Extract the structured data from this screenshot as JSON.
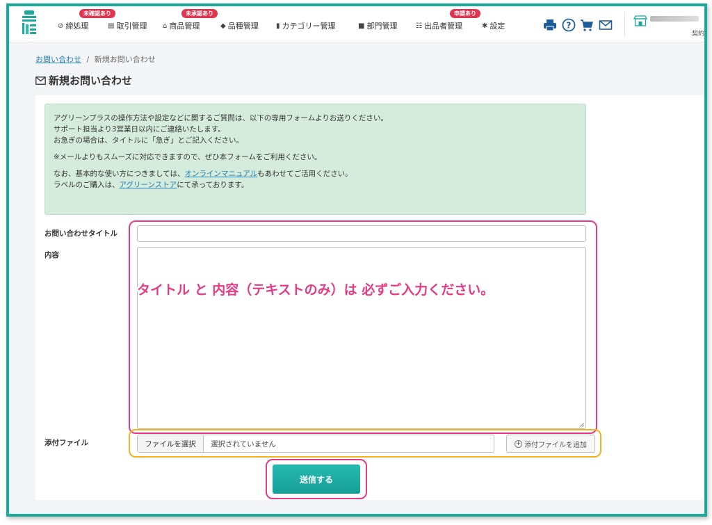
{
  "nav": {
    "items": [
      {
        "label": "締処理",
        "icon": "check-circle-icon",
        "badge": "未確認あり"
      },
      {
        "label": "取引管理",
        "icon": "ledger-icon",
        "badge": ""
      },
      {
        "label": "商品管理",
        "icon": "shop-icon",
        "badge": "未承認あり"
      },
      {
        "label": "品種管理",
        "icon": "tag-icon",
        "badge": ""
      },
      {
        "label": "カテゴリー管理",
        "icon": "bookmark-icon",
        "badge": ""
      },
      {
        "label": "部門管理",
        "icon": "folder-icon",
        "badge": ""
      },
      {
        "label": "出品者管理",
        "icon": "users-icon",
        "badge": "申請あり"
      },
      {
        "label": "設定",
        "icon": "gear-icon",
        "badge": ""
      }
    ],
    "tools": [
      "print-icon",
      "help-icon",
      "cart-icon",
      "mail-icon"
    ],
    "contract_label": "契約",
    "accent": "#1aaa9c",
    "badge_color": "#e0344f"
  },
  "breadcrumb": {
    "parent": "お問い合わせ",
    "separator": "/",
    "current": "新規お問い合わせ"
  },
  "page": {
    "title": "新規お問い合わせ",
    "title_icon": "mail-outline-icon"
  },
  "notice": {
    "line1": "アグリーンプラスの操作方法や設定などに関するご質問は、以下の専用フォームよりお送りください。",
    "line2": "サポート担当より3営業日以内にご連絡いたします。",
    "line3": "お急ぎの場合は、タイトルに「急ぎ」とご記入ください。",
    "line4": "※メールよりもスムーズに対応できますので、ぜひ本フォームをご利用ください。",
    "line5_pre": "なお、基本的な使い方につきましては、",
    "line5_link": "オンラインマニュアル",
    "line5_post": "もあわせてご活用ください。",
    "line6_pre": "ラベルのご購入は、",
    "line6_link": "アグリーンストア",
    "line6_post": "にて承っております。"
  },
  "form": {
    "title_label": "お問い合わせタイトル",
    "title_value": "",
    "content_label": "内容",
    "content_value": "",
    "attachment_label": "添付ファイル",
    "file_button": "ファイルを選択",
    "file_status": "選択されていません",
    "add_file_button": "添付ファイルを追加",
    "submit": "送信する"
  },
  "annotation": {
    "text": "タイトル と 内容（テキストのみ）は 必ずご入力ください。"
  }
}
